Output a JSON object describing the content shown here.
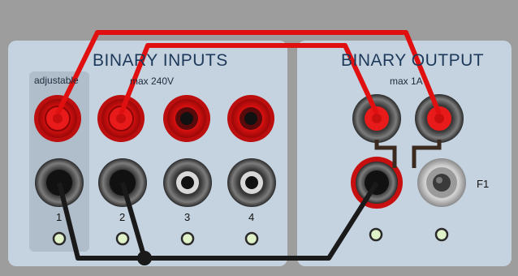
{
  "panel": {
    "inputs_title": "BINARY INPUTS",
    "output_title": "BINARY OUTPUT",
    "adjustable_label": "adjustable",
    "inputs_max_label": "max 240V",
    "output_max_label": "max 1A",
    "channel_labels": [
      "1",
      "2",
      "3",
      "4"
    ],
    "fuse_label": "F1"
  },
  "colors": {
    "background": "#9d9d9d",
    "panel": "#c7d3e0",
    "socket_red": "#e01818",
    "wire_red": "#e01010",
    "wire_black": "#1a1a1a",
    "led_green": "#dff2c8"
  }
}
